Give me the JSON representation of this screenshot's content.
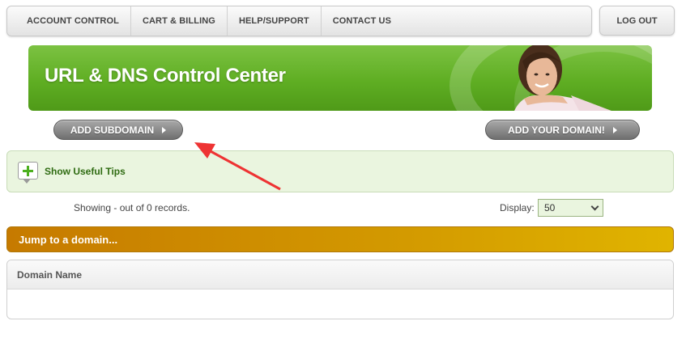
{
  "topnav": {
    "items": [
      {
        "label": "ACCOUNT CONTROL"
      },
      {
        "label": "CART & BILLING"
      },
      {
        "label": "HELP/SUPPORT"
      },
      {
        "label": "CONTACT US"
      }
    ],
    "logout_label": "LOG OUT"
  },
  "banner": {
    "title": "URL & DNS Control Center"
  },
  "buttons": {
    "add_subdomain": "ADD SUBDOMAIN",
    "add_domain": "ADD YOUR DOMAIN!"
  },
  "tips": {
    "label": "Show Useful Tips"
  },
  "records": {
    "showing_text": "Showing - out of 0 records.",
    "display_label": "Display:",
    "display_value": "50"
  },
  "jump": {
    "label": "Jump to a domain..."
  },
  "table": {
    "columns": [
      "Domain Name"
    ]
  },
  "colors": {
    "banner_green": "#5fae23",
    "jump_orange": "#c67a00",
    "annotation_arrow": "#ee3333"
  }
}
